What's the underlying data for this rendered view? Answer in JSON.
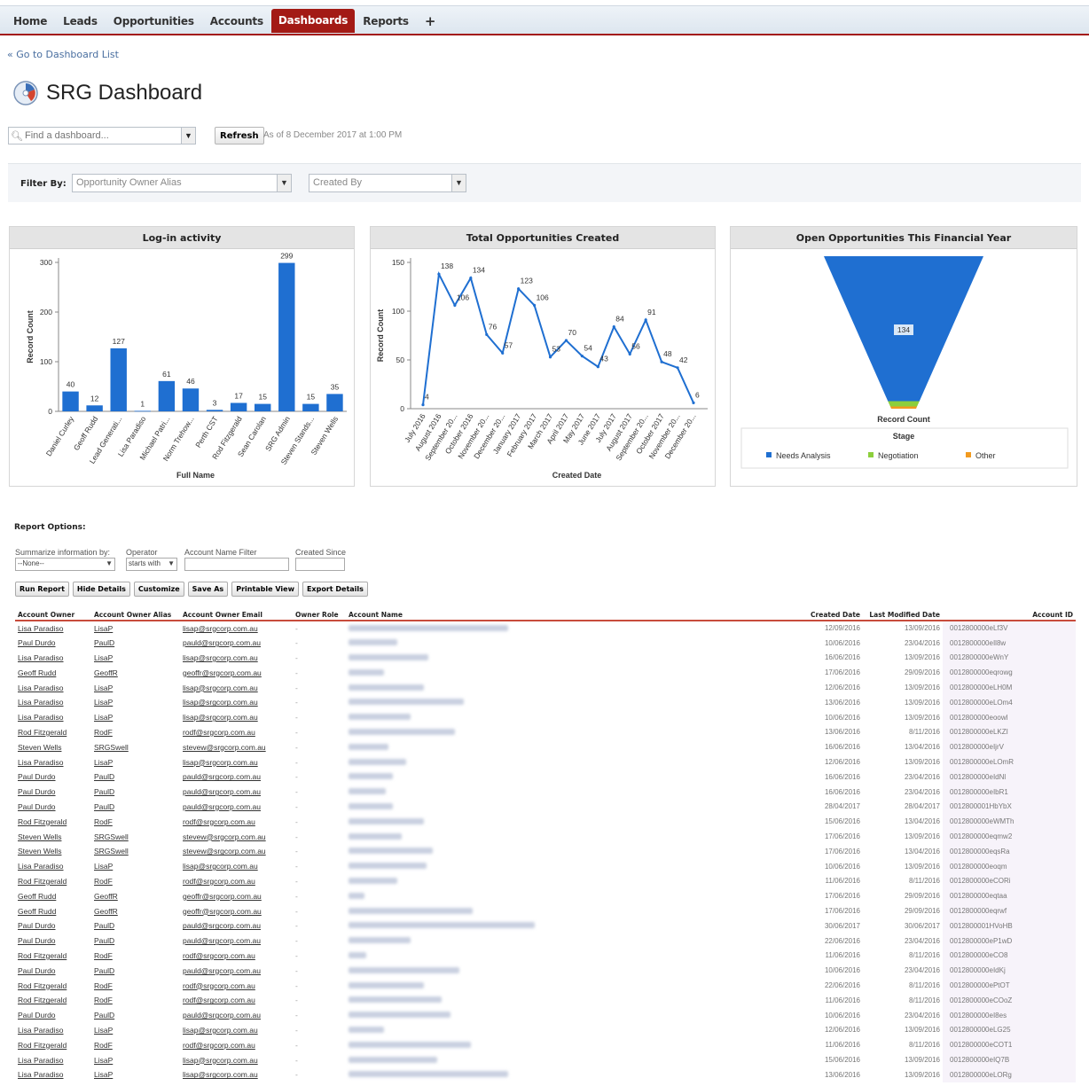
{
  "nav": {
    "tabs": [
      "Home",
      "Leads",
      "Opportunities",
      "Accounts",
      "Dashboards",
      "Reports",
      "+"
    ],
    "active": "Dashboards"
  },
  "back_link": "« Go to Dashboard List",
  "page_title": "SRG Dashboard",
  "toolbar": {
    "find_placeholder": "Find a dashboard...",
    "refresh_label": "Refresh",
    "as_of": "As of 8 December 2017 at 1:00 PM"
  },
  "filter": {
    "label": "Filter By:",
    "owner_placeholder": "Opportunity Owner Alias",
    "created_placeholder": "Created By"
  },
  "colors": {
    "bar": "#1f6fd1",
    "accent": "#a31a15",
    "negotiation": "#8ccf3c",
    "other": "#f29a1f"
  },
  "chart_data": [
    {
      "type": "bar",
      "title": "Log-in activity",
      "xlabel": "Full Name",
      "ylabel": "Record Count",
      "ylim": [
        0,
        300
      ],
      "yticks": [
        0,
        100,
        200,
        300
      ],
      "categories": [
        "Daniel Curley",
        "Geoff Rudd",
        "Lead Generati...",
        "Lisa Paradiso",
        "Michael Patri...",
        "Norm Trehow...",
        "Perth CST",
        "Rod Fitzgerald",
        "Sean Carolan",
        "SRG Admin",
        "Steven Stands...",
        "Steven Wells"
      ],
      "values": [
        40,
        12,
        127,
        1,
        61,
        46,
        3,
        17,
        15,
        299,
        15,
        35
      ]
    },
    {
      "type": "line",
      "title": "Total Opportunities Created",
      "xlabel": "Created Date",
      "ylabel": "Record Count",
      "ylim": [
        0,
        150
      ],
      "yticks": [
        0,
        50,
        100,
        150
      ],
      "categories": [
        "July 2016",
        "August 2016",
        "September 20...",
        "October 2016",
        "November 20...",
        "December 20...",
        "January 2017",
        "February 2017",
        "March 2017",
        "April 2017",
        "May 2017",
        "June 2017",
        "July 2017",
        "August 2017",
        "September 20...",
        "October 2017",
        "November 20...",
        "December 20..."
      ],
      "values": [
        4,
        138,
        106,
        134,
        76,
        57,
        123,
        106,
        53,
        70,
        54,
        43,
        84,
        56,
        91,
        48,
        42,
        6
      ]
    },
    {
      "type": "funnel",
      "title": "Open Opportunities This Financial Year",
      "xlabel": "Record Count",
      "legend_title": "Stage",
      "series": [
        {
          "name": "Needs Analysis",
          "value": 134
        },
        {
          "name": "Negotiation",
          "value": 5
        },
        {
          "name": "Other",
          "value": 2
        }
      ]
    }
  ],
  "report": {
    "title": "Report Options:",
    "summarize_label": "Summarize information by:",
    "summarize_value": "--None--",
    "operator_label": "Operator",
    "operator_value": "starts with",
    "filter_label": "Account Name Filter",
    "since_label": "Created Since",
    "buttons": [
      "Run Report",
      "Hide Details",
      "Customize",
      "Save As",
      "Printable View",
      "Export Details"
    ],
    "columns": [
      "Account Owner",
      "Account Owner Alias",
      "Account Owner Email",
      "Owner Role",
      "Account Name",
      "Created Date",
      "Last Modified Date",
      "Account ID"
    ],
    "rows": [
      [
        "Lisa Paradiso",
        "LisaP",
        "lisap@srgcorp.com.au",
        "-",
        "",
        "12/09/2016",
        "13/09/2016",
        "0012800000eLf3V"
      ],
      [
        "Paul Durdo",
        "PaulD",
        "pauld@srgcorp.com.au",
        "-",
        "",
        "10/06/2016",
        "23/04/2016",
        "0012800000eIl8w"
      ],
      [
        "Lisa Paradiso",
        "LisaP",
        "lisap@srgcorp.com.au",
        "-",
        "",
        "16/06/2016",
        "13/09/2016",
        "0012800000eWnY"
      ],
      [
        "Geoff Rudd",
        "GeoffR",
        "geoffr@srgcorp.com.au",
        "-",
        "",
        "17/06/2016",
        "29/09/2016",
        "0012800000eqrowg"
      ],
      [
        "Lisa Paradiso",
        "LisaP",
        "lisap@srgcorp.com.au",
        "-",
        "",
        "12/06/2016",
        "13/09/2016",
        "0012800000eLH0M"
      ],
      [
        "Lisa Paradiso",
        "LisaP",
        "lisap@srgcorp.com.au",
        "-",
        "",
        "13/06/2016",
        "13/09/2016",
        "0012800000eLOm4"
      ],
      [
        "Lisa Paradiso",
        "LisaP",
        "lisap@srgcorp.com.au",
        "-",
        "",
        "10/06/2016",
        "13/09/2016",
        "0012800000eoowl"
      ],
      [
        "Rod Fitzgerald",
        "RodF",
        "rodf@srgcorp.com.au",
        "-",
        "",
        "13/06/2016",
        "8/11/2016",
        "0012800000eLKZI"
      ],
      [
        "Steven Wells",
        "SRGSwell",
        "stevew@srgcorp.com.au",
        "-",
        "",
        "16/06/2016",
        "13/04/2016",
        "0012800000eIjrV"
      ],
      [
        "Lisa Paradiso",
        "LisaP",
        "lisap@srgcorp.com.au",
        "-",
        "",
        "12/06/2016",
        "13/09/2016",
        "0012800000eLOmR"
      ],
      [
        "Paul Durdo",
        "PaulD",
        "pauld@srgcorp.com.au",
        "-",
        "",
        "16/06/2016",
        "23/04/2016",
        "0012800000eIdNl"
      ],
      [
        "Paul Durdo",
        "PaulD",
        "pauld@srgcorp.com.au",
        "-",
        "",
        "16/06/2016",
        "23/04/2016",
        "0012800000eIbR1"
      ],
      [
        "Paul Durdo",
        "PaulD",
        "pauld@srgcorp.com.au",
        "-",
        "",
        "28/04/2017",
        "28/04/2017",
        "0012800001HbYbX"
      ],
      [
        "Rod Fitzgerald",
        "RodF",
        "rodf@srgcorp.com.au",
        "-",
        "",
        "15/06/2016",
        "13/04/2016",
        "0012800000eWMTh"
      ],
      [
        "Steven Wells",
        "SRGSwell",
        "stevew@srgcorp.com.au",
        "-",
        "",
        "17/06/2016",
        "13/09/2016",
        "0012800000eqmw2"
      ],
      [
        "Steven Wells",
        "SRGSwell",
        "stevew@srgcorp.com.au",
        "-",
        "",
        "17/06/2016",
        "13/04/2016",
        "0012800000eqsRa"
      ],
      [
        "Lisa Paradiso",
        "LisaP",
        "lisap@srgcorp.com.au",
        "-",
        "",
        "10/06/2016",
        "13/09/2016",
        "0012800000eoqm"
      ],
      [
        "Rod Fitzgerald",
        "RodF",
        "rodf@srgcorp.com.au",
        "-",
        "",
        "11/06/2016",
        "8/11/2016",
        "0012800000eCORi"
      ],
      [
        "Geoff Rudd",
        "GeoffR",
        "geoffr@srgcorp.com.au",
        "-",
        "",
        "17/06/2016",
        "29/09/2016",
        "0012800000eqtaa"
      ],
      [
        "Geoff Rudd",
        "GeoffR",
        "geoffr@srgcorp.com.au",
        "-",
        "",
        "17/06/2016",
        "29/09/2016",
        "0012800000eqrwf"
      ],
      [
        "Paul Durdo",
        "PaulD",
        "pauld@srgcorp.com.au",
        "-",
        "",
        "30/06/2017",
        "30/06/2017",
        "0012800001HVoHB"
      ],
      [
        "Paul Durdo",
        "PaulD",
        "pauld@srgcorp.com.au",
        "-",
        "",
        "22/06/2016",
        "23/04/2016",
        "0012800000eP1wD"
      ],
      [
        "Rod Fitzgerald",
        "RodF",
        "rodf@srgcorp.com.au",
        "-",
        "",
        "11/06/2016",
        "8/11/2016",
        "0012800000eCO8"
      ],
      [
        "Paul Durdo",
        "PaulD",
        "pauld@srgcorp.com.au",
        "-",
        "",
        "10/06/2016",
        "23/04/2016",
        "0012800000eIdKj"
      ],
      [
        "Rod Fitzgerald",
        "RodF",
        "rodf@srgcorp.com.au",
        "-",
        "",
        "22/06/2016",
        "8/11/2016",
        "0012800000ePtOT"
      ],
      [
        "Rod Fitzgerald",
        "RodF",
        "rodf@srgcorp.com.au",
        "-",
        "",
        "11/06/2016",
        "8/11/2016",
        "0012800000eCOoZ"
      ],
      [
        "Paul Durdo",
        "PaulD",
        "pauld@srgcorp.com.au",
        "-",
        "",
        "10/06/2016",
        "23/04/2016",
        "0012800000eI8es"
      ],
      [
        "Lisa Paradiso",
        "LisaP",
        "lisap@srgcorp.com.au",
        "-",
        "",
        "12/06/2016",
        "13/09/2016",
        "0012800000eLG25"
      ],
      [
        "Rod Fitzgerald",
        "RodF",
        "rodf@srgcorp.com.au",
        "-",
        "",
        "11/06/2016",
        "8/11/2016",
        "0012800000eCOT1"
      ],
      [
        "Lisa Paradiso",
        "LisaP",
        "lisap@srgcorp.com.au",
        "-",
        "",
        "15/06/2016",
        "13/09/2016",
        "0012800000eIQ7B"
      ],
      [
        "Lisa Paradiso",
        "LisaP",
        "lisap@srgcorp.com.au",
        "-",
        "",
        "13/06/2016",
        "13/09/2016",
        "0012800000eLORg"
      ]
    ]
  }
}
